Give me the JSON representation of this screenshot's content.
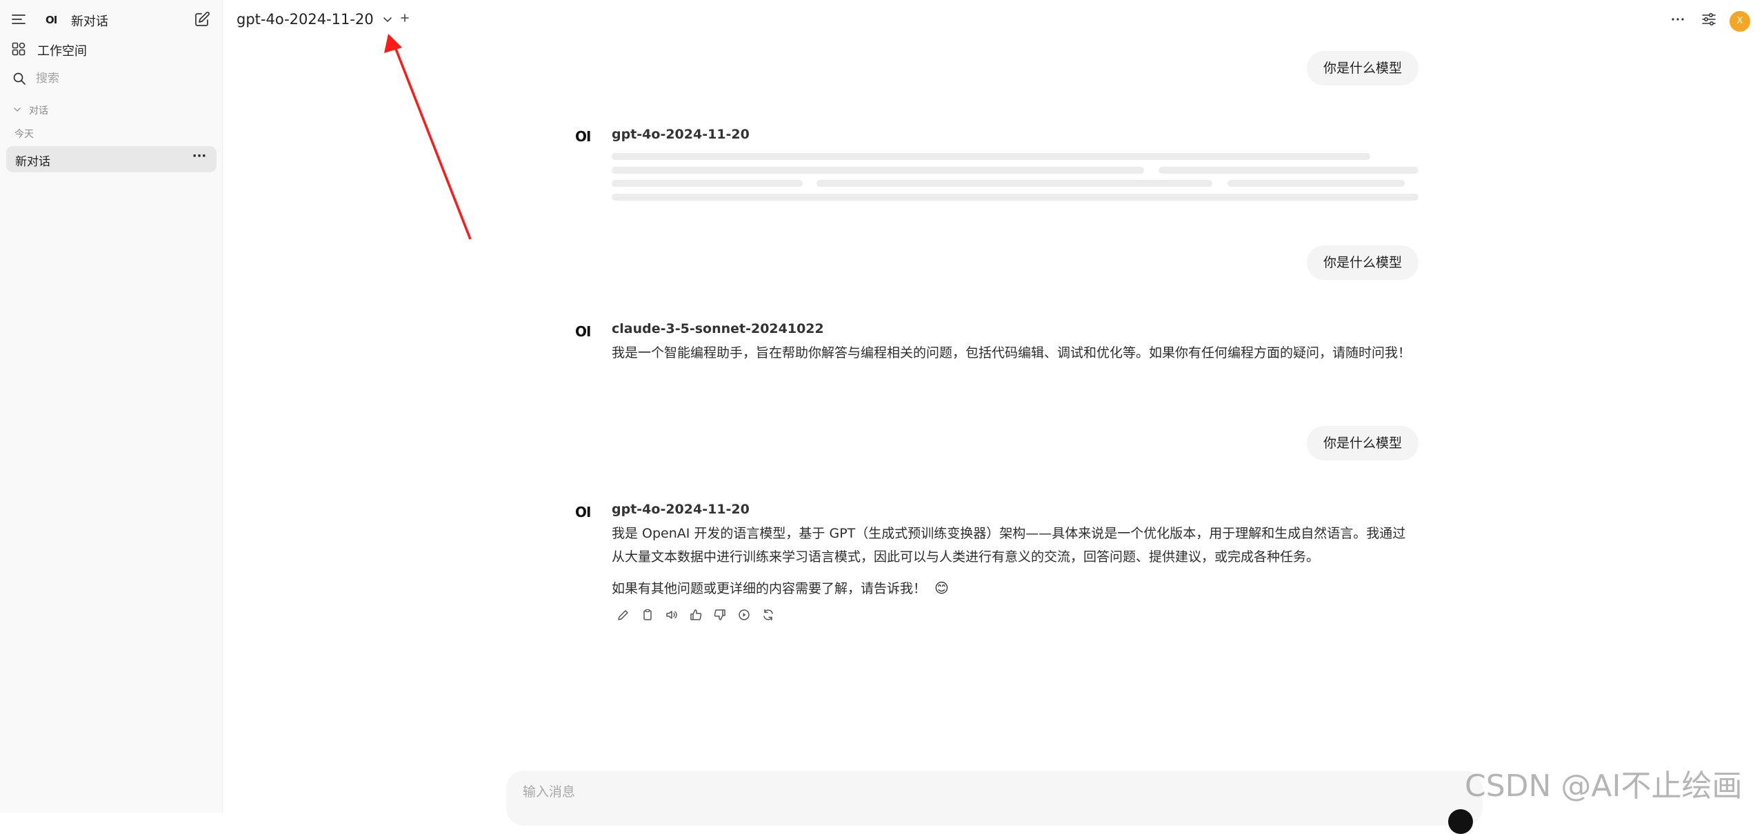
{
  "sidebar": {
    "logo": "OI",
    "new_chat_label": "新对话",
    "workspace_label": "工作空间",
    "search_placeholder": "搜索",
    "section_label": "对话",
    "today_label": "今天",
    "chat_items": [
      {
        "label": "新对话",
        "more": "···"
      }
    ]
  },
  "header": {
    "model_name": "gpt-4o-2024-11-20",
    "avatar_initial": "X"
  },
  "messages": [
    {
      "role": "user",
      "text": "你是什么模型"
    },
    {
      "role": "assistant",
      "logo": "OI",
      "model": "gpt-4o-2024-11-20",
      "loading": true
    },
    {
      "role": "user",
      "text": "你是什么模型"
    },
    {
      "role": "assistant",
      "logo": "OI",
      "model": "claude-3-5-sonnet-20241022",
      "paragraphs": [
        "我是一个智能编程助手，旨在帮助你解答与编程相关的问题，包括代码编辑、调试和优化等。如果你有任何编程方面的疑问，请随时问我！"
      ]
    },
    {
      "role": "user",
      "text": "你是什么模型"
    },
    {
      "role": "assistant",
      "logo": "OI",
      "model": "gpt-4o-2024-11-20",
      "paragraphs": [
        "我是 OpenAI 开发的语言模型，基于 GPT（生成式预训练变换器）架构——具体来说是一个优化版本，用于理解和生成自然语言。我通过从大量文本数据中进行训练来学习语言模式，因此可以与人类进行有意义的交流，回答问题、提供建议，或完成各种任务。",
        "如果有其他问题或更详细的内容需要了解，请告诉我！"
      ],
      "emoji": "😊"
    }
  ],
  "actions": [
    "edit-icon",
    "copy-icon",
    "speaker-icon",
    "thumbs-up-icon",
    "thumbs-down-icon",
    "play-icon",
    "regenerate-icon"
  ],
  "input": {
    "placeholder": "输入消息"
  },
  "watermark": "CSDN @AI不止绘画",
  "colors": {
    "avatar": "#f5a623",
    "arrow": "#ff1a1a",
    "sidebar_bg": "#f9f9f9"
  }
}
